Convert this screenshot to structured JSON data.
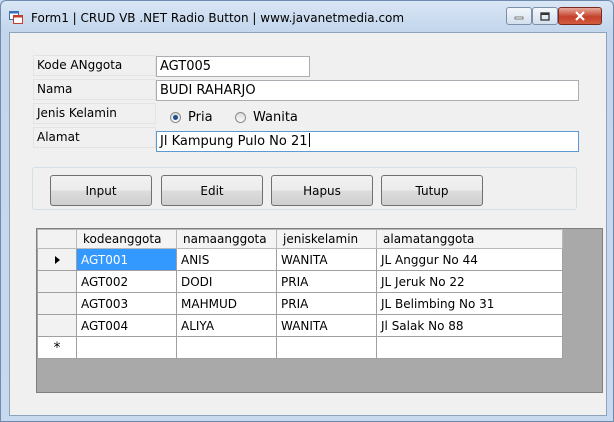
{
  "window": {
    "title": "Form1 | CRUD VB .NET Radio Button | www.javanetmedia.com",
    "icon": "form-app-icon"
  },
  "form": {
    "kode_label": "Kode ANggota",
    "kode_value": "AGT005",
    "nama_label": "Nama",
    "nama_value": "BUDI RAHARJO",
    "jk_label": "Jenis Kelamin",
    "jk_options": [
      {
        "label": "Pria",
        "checked": true
      },
      {
        "label": "Wanita",
        "checked": false
      }
    ],
    "alamat_label": "Alamat",
    "alamat_value": "Jl Kampung Pulo No 21"
  },
  "buttons": {
    "input": "Input",
    "edit": "Edit",
    "hapus": "Hapus",
    "tutup": "Tutup"
  },
  "table": {
    "columns": [
      "kodeanggota",
      "namaanggota",
      "jeniskelamin",
      "alamatanggota"
    ],
    "rows": [
      [
        "AGT001",
        "ANIS",
        "WANITA",
        "JL Anggur No 44"
      ],
      [
        "AGT002",
        "DODI",
        "PRIA",
        "JL Jeruk No 22"
      ],
      [
        "AGT003",
        "MAHMUD",
        "PRIA",
        "JL Belimbing No 31"
      ],
      [
        "AGT004",
        "ALIYA",
        "WANITA",
        "Jl Salak No 88"
      ]
    ],
    "new_row_marker": "*",
    "current_row_icon": "current-row-arrow-icon"
  },
  "colors": {
    "selection": "#3399ff",
    "close_button": "#c5412b"
  }
}
